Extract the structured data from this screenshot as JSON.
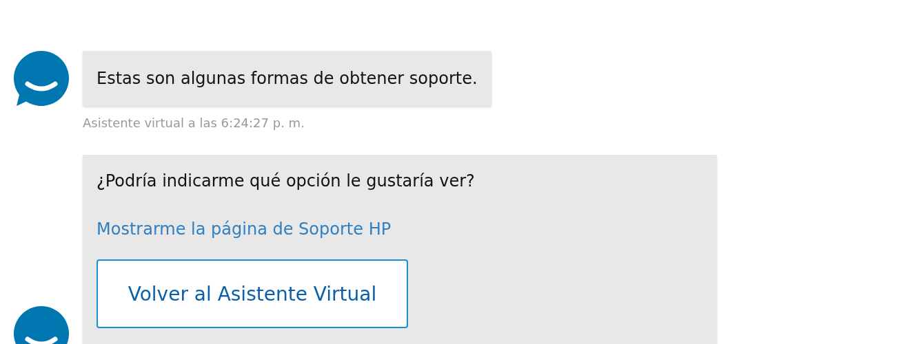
{
  "messages": [
    {
      "kind": "text",
      "text": "Estas son algunas formas de obtener soporte.",
      "meta": "Asistente virtual a las 6:24:27 p. m."
    },
    {
      "kind": "options",
      "text": "¿Podría indicarme qué opción le gustaría ver?",
      "link": "Mostrarme la página de Soporte HP",
      "button": "Volver al Asistente Virtual"
    }
  ]
}
